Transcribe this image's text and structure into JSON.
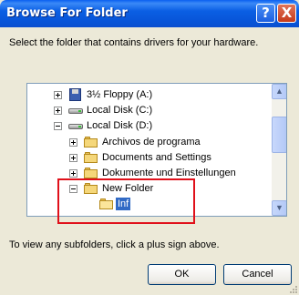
{
  "window": {
    "title": "Browse For Folder",
    "help_symbol": "?",
    "close_symbol": "X"
  },
  "instruction": "Select the folder that contains drivers for your hardware.",
  "tree": {
    "items": [
      {
        "label": "3½ Floppy (A:)",
        "icon": "floppy-drive-icon",
        "expander": "plus"
      },
      {
        "label": "Local Disk (C:)",
        "icon": "hard-drive-icon",
        "expander": "plus"
      },
      {
        "label": "Local Disk (D:)",
        "icon": "hard-drive-icon",
        "expander": "minus"
      },
      {
        "label": "Archivos de programa",
        "icon": "folder-icon",
        "expander": "plus"
      },
      {
        "label": "Documents and Settings",
        "icon": "folder-icon",
        "expander": "plus"
      },
      {
        "label": "Dokumente und Einstellungen",
        "icon": "folder-icon",
        "expander": "plus"
      },
      {
        "label": "New Folder",
        "icon": "folder-icon",
        "expander": "minus"
      },
      {
        "label": "Inf",
        "icon": "open-folder-icon",
        "expander": "none",
        "selected": true
      }
    ]
  },
  "hint": "To view any subfolders, click a plus sign above.",
  "buttons": {
    "ok": "OK",
    "cancel": "Cancel"
  },
  "scrollbar": {
    "up": "▲",
    "down": "▼"
  },
  "colors": {
    "title_bar": "#0b5fe4",
    "selection": "#316ac5",
    "highlight_box": "#e0101a",
    "dialog_bg": "#ece9d8"
  }
}
